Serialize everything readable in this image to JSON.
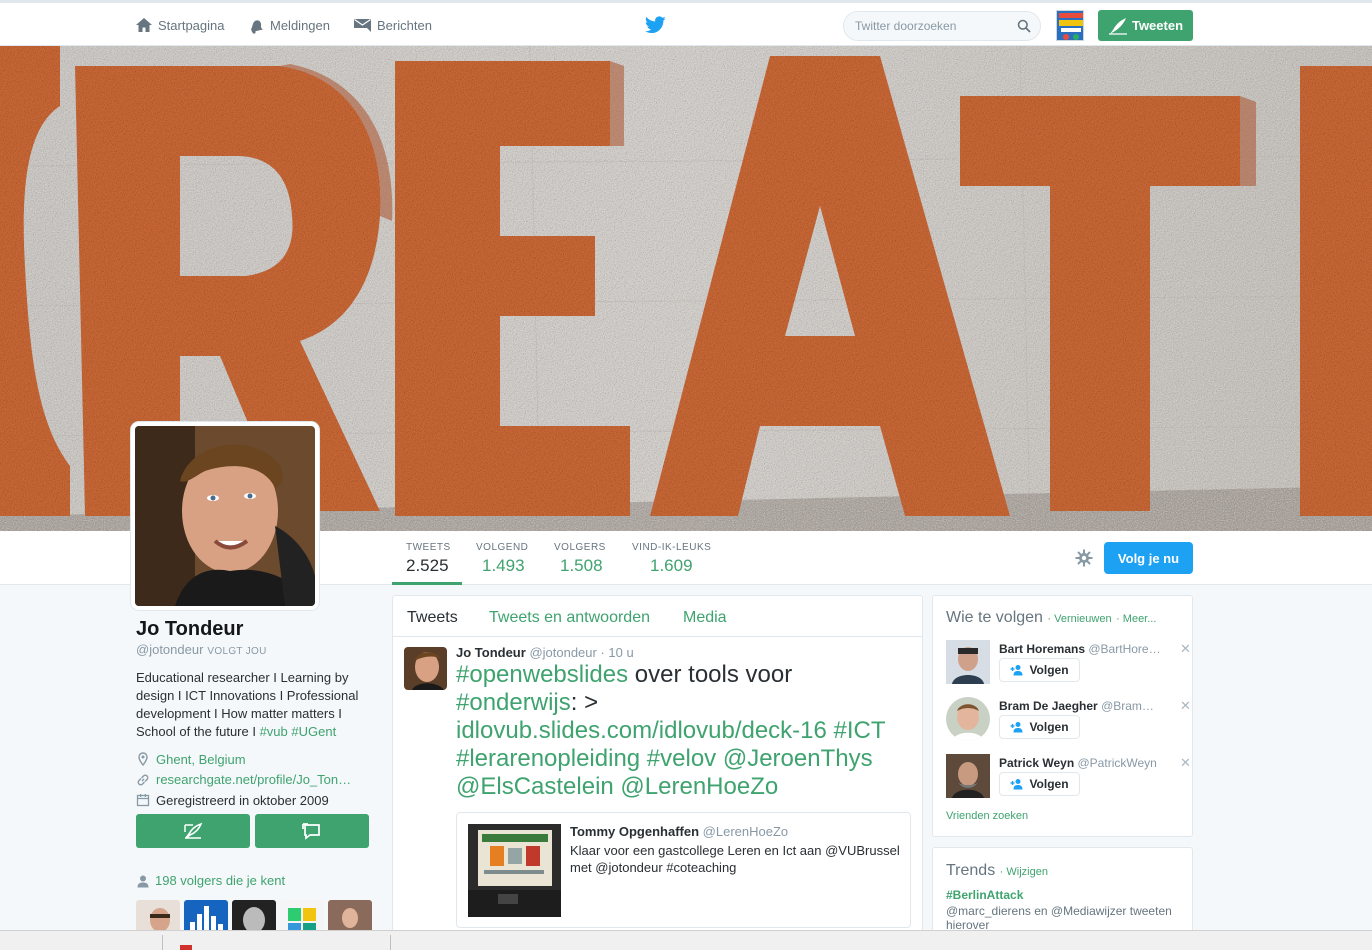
{
  "nav": {
    "home": "Startpagina",
    "notifications": "Meldingen",
    "messages": "Berichten",
    "search_placeholder": "Twitter doorzoeken",
    "tweet_button": "Tweeten"
  },
  "profile_nav": {
    "stats": [
      {
        "label": "TWEETS",
        "value": "2.525"
      },
      {
        "label": "VOLGEND",
        "value": "1.493"
      },
      {
        "label": "VOLGERS",
        "value": "1.508"
      },
      {
        "label": "VIND-IK-LEUKS",
        "value": "1.609"
      }
    ],
    "follow_button": "Volg je nu"
  },
  "profile": {
    "name": "Jo Tondeur",
    "handle": "@jotondeur",
    "follows_you": "VOLGT JOU",
    "bio_text": "Educational researcher I Learning by design I ICT Innovations I Professional development I How matter matters I School of the future I ",
    "bio_tags": "#vub #UGent",
    "location": "Ghent, Belgium",
    "website": "researchgate.net/profile/Jo_Ton…",
    "joined": "Geregistreerd in oktober 2009",
    "followers_you_know": "198 volgers die je kent"
  },
  "timeline": {
    "tabs": [
      "Tweets",
      "Tweets en antwoorden",
      "Media"
    ],
    "tweet": {
      "name": "Jo Tondeur",
      "handle": "@jotondeur",
      "time": "· 10 u",
      "text": {
        "p1": "#openwebslides",
        "p2": " over tools voor ",
        "p3": "#onderwijs",
        "p4": ": > ",
        "p5": "idlovub.slides.com/idlovub/deck-16",
        "p6": " #ICT #lerarenopleiding #velov @JeroenThys @ElsCastelein @LerenHoeZo"
      },
      "quote": {
        "name": "Tommy Opgenhaffen",
        "handle": "@LerenHoeZo",
        "text": "Klaar voor een gastcollege Leren en Ict aan @VUBrussel met @jotondeur #coteaching"
      }
    }
  },
  "who_to_follow": {
    "title": "Wie te volgen",
    "refresh": "· Vernieuwen",
    "more": "· Meer...",
    "follow_label": "Volgen",
    "suggestions": [
      {
        "name": "Bart Horemans",
        "handle": "@BartHore…"
      },
      {
        "name": "Bram De Jaegher",
        "handle": "@Bram…"
      },
      {
        "name": "Patrick Weyn",
        "handle": "@PatrickWeyn"
      }
    ],
    "find_friends": "Vrienden zoeken"
  },
  "trends": {
    "title": "Trends",
    "change": "· Wijzigen",
    "items": [
      {
        "tag": "#BerlinAttack",
        "desc": "@marc_dierens en @Mediawijzer tweeten hierover"
      }
    ]
  },
  "colors": {
    "accent": "#3fa36f",
    "follow_blue": "#1da1f2",
    "banner_orange": "#d9703a"
  }
}
